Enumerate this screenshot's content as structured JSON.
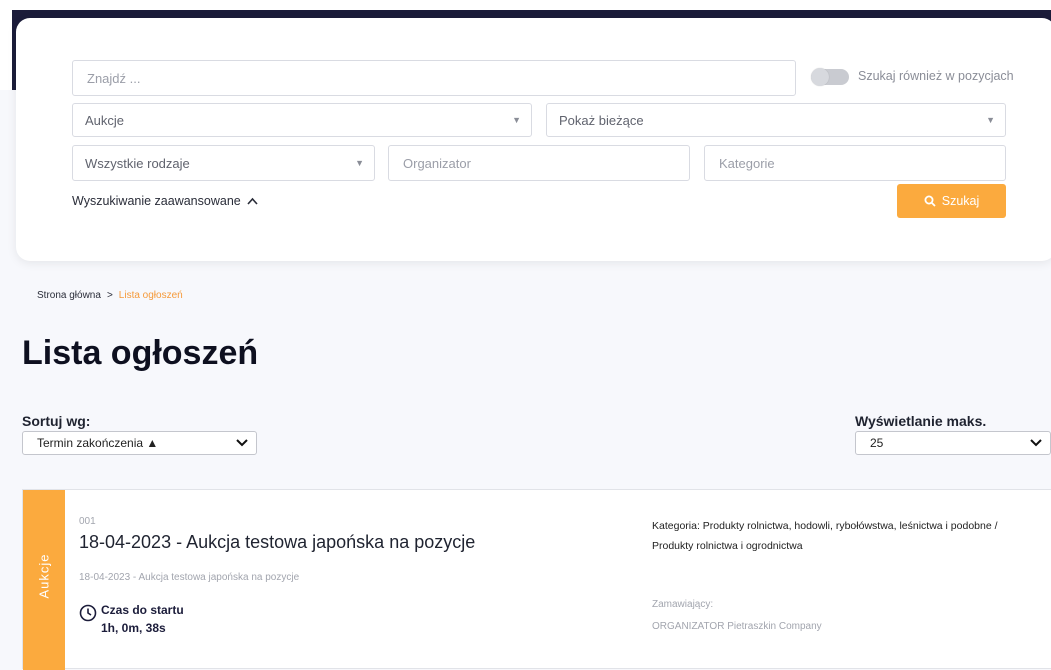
{
  "search": {
    "find_placeholder": "Znajdź ...",
    "toggle_label": "Szukaj również w pozycjach",
    "type_select": "Aukcje",
    "status_select": "Pokaż bieżące",
    "kind_select": "Wszystkie rodzaje",
    "organizer_placeholder": "Organizator",
    "category_placeholder": "Kategorie",
    "advanced_label": "Wyszukiwanie zaawansowane",
    "search_button": "Szukaj"
  },
  "breadcrumb": {
    "home": "Strona główna",
    "separator": ">",
    "current": "Lista ogłoszeń"
  },
  "page_title": "Lista ogłoszeń",
  "sort": {
    "label": "Sortuj wg:",
    "value": "Termin zakończenia ▲"
  },
  "max_display": {
    "label": "Wyświetlanie maks.",
    "value": "25"
  },
  "listing": {
    "ribbon": "Aukcje",
    "number": "001",
    "title": "18-04-2023 - Aukcja testowa japońska na pozycje",
    "subtitle": "18-04-2023 - Aukcja testowa japońska na pozycje",
    "countdown_label": "Czas do startu",
    "countdown_value": "1h, 0m, 38s",
    "category": "Kategoria: Produkty rolnictwa, hodowli, rybołówstwa, leśnictwa i podobne / Produkty rolnictwa i ogrodnictwa",
    "orderer_label": "Zamawiający:",
    "orderer_value": "ORGANIZATOR Pietraszkin Company"
  },
  "colors": {
    "accent": "#fbaa3e",
    "header_dark": "#1b1c3a",
    "breadcrumb_current": "#f59a3a"
  },
  "icons": [
    "chevron-down-icon",
    "chevron-up-icon",
    "search-icon",
    "clock-icon"
  ]
}
